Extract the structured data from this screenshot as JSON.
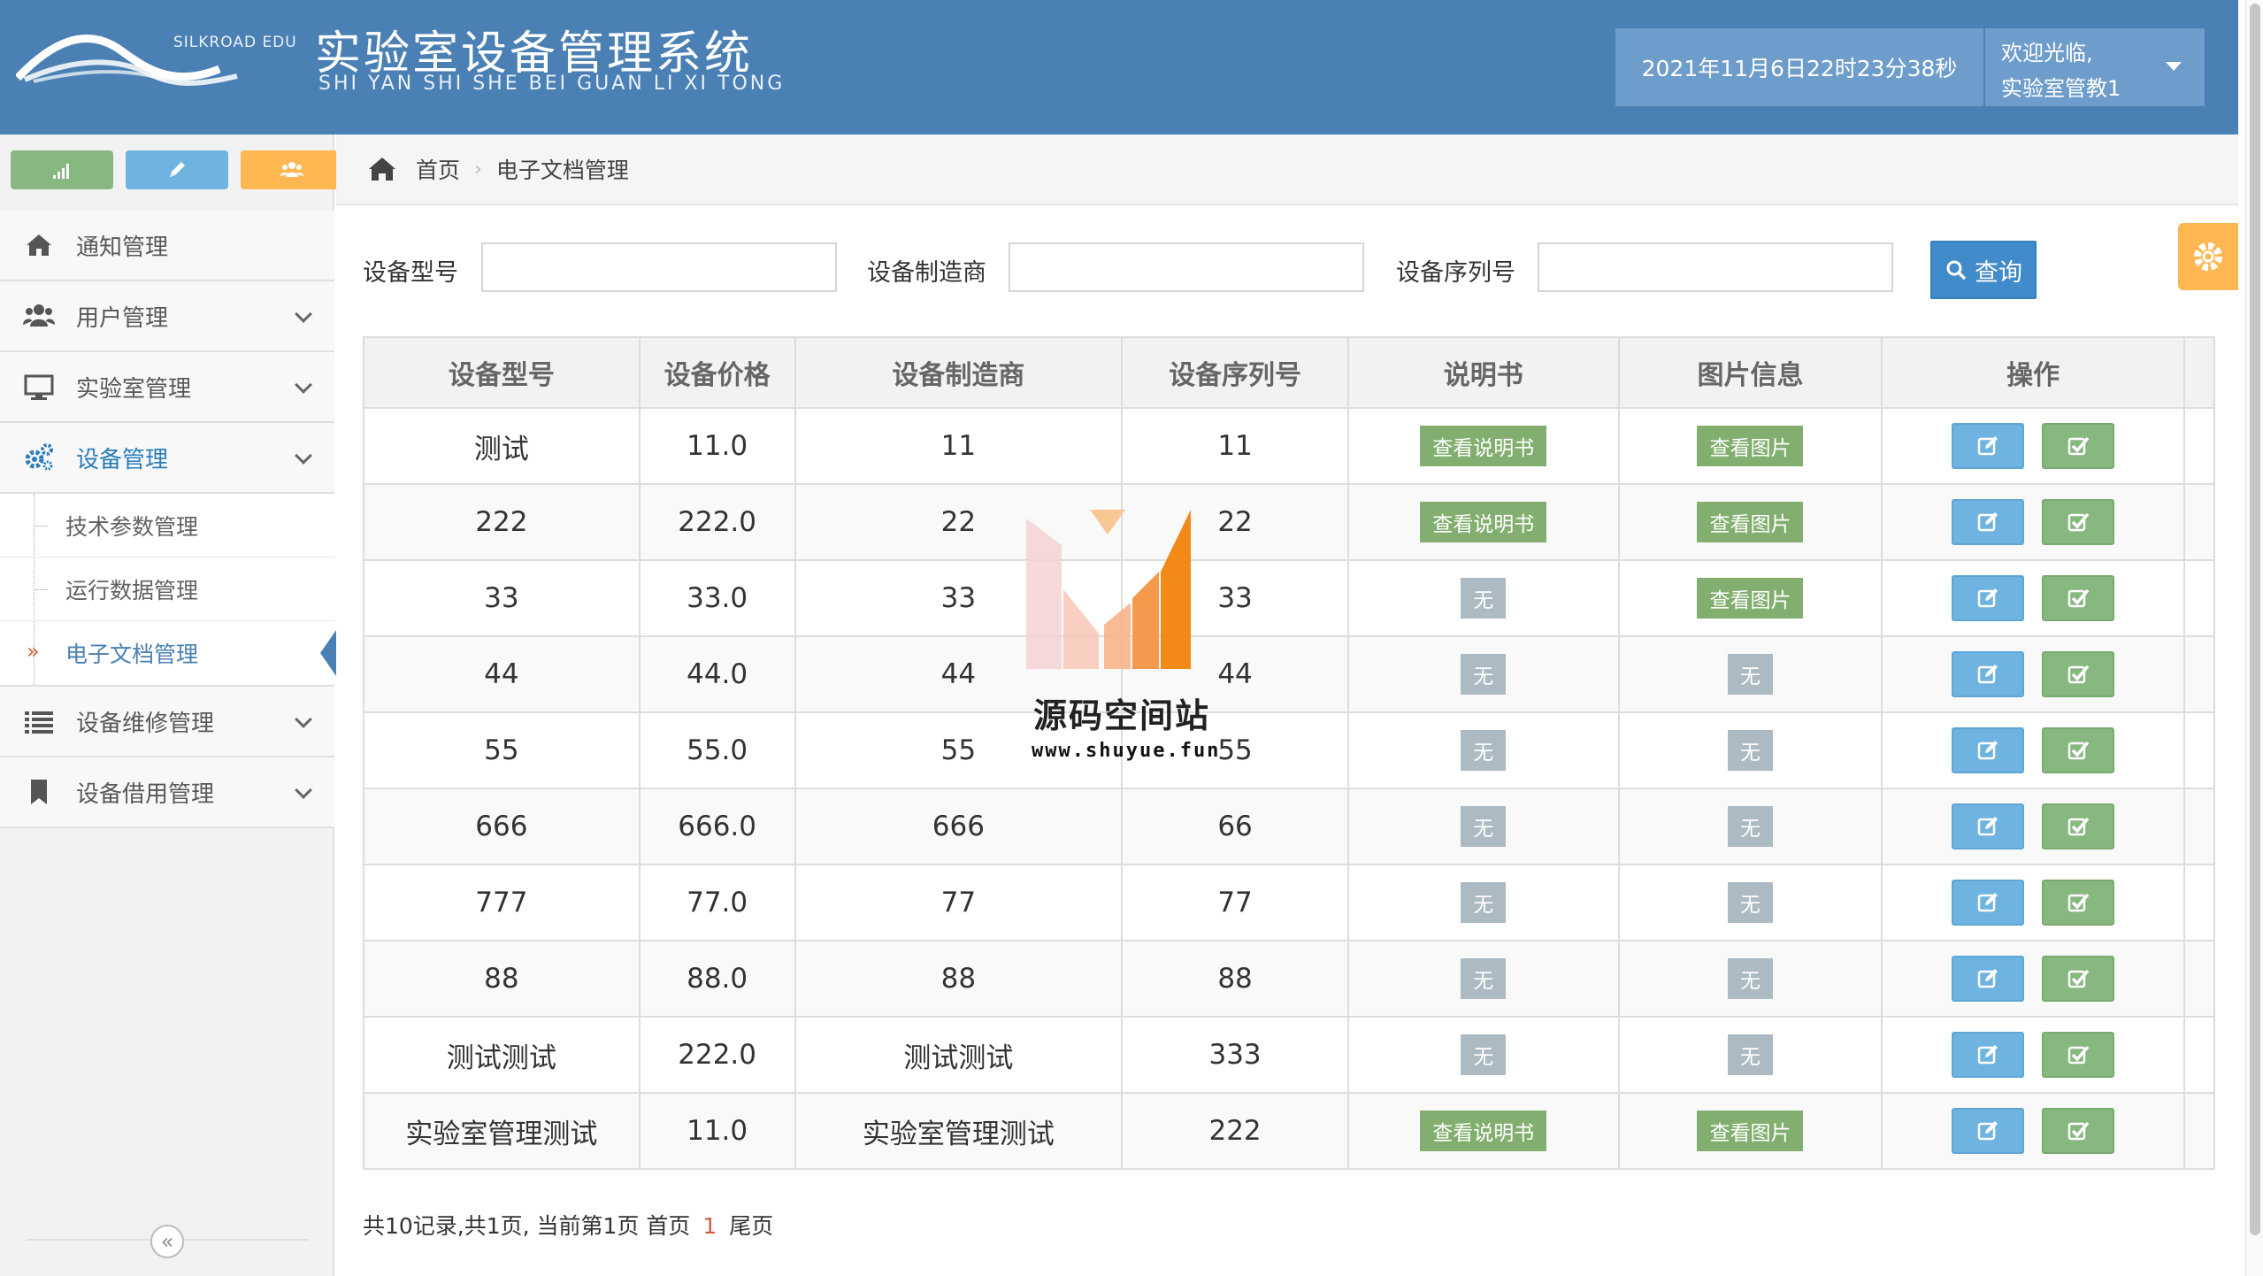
{
  "header": {
    "logo_text": "SILKROAD EDU",
    "title": "实验室设备管理系统",
    "pinyin": "SHI YAN SHI SHE BEI GUAN LI XI TONG",
    "datetime": "2021年11月6日22时23分38秒",
    "welcome": "欢迎光临,",
    "username": "实验室管教1"
  },
  "sidebar": {
    "shortcuts": [
      {
        "icon": "signal-icon",
        "color": "#87b87f"
      },
      {
        "icon": "pencil-icon",
        "color": "#6fb3e0"
      },
      {
        "icon": "users-icon",
        "color": "#ffb752"
      },
      {
        "icon": "cogs-icon",
        "color": "#d15b47"
      }
    ],
    "items": [
      {
        "label": "通知管理",
        "icon": "home-icon"
      },
      {
        "label": "用户管理",
        "icon": "users-icon"
      },
      {
        "label": "实验室管理",
        "icon": "desktop-icon"
      },
      {
        "label": "设备管理",
        "icon": "cogs-icon"
      },
      {
        "label": "设备维修管理",
        "icon": "list-icon"
      },
      {
        "label": "设备借用管理",
        "icon": "bookmark-icon"
      }
    ],
    "subitems": [
      {
        "label": "技术参数管理"
      },
      {
        "label": "运行数据管理"
      },
      {
        "label": "电子文档管理"
      }
    ],
    "collapse_symbol": "«"
  },
  "breadcrumb": {
    "home": "首页",
    "separator": "›",
    "current": "电子文档管理"
  },
  "search": {
    "model_label": "设备型号",
    "maker_label": "设备制造商",
    "serial_label": "设备序列号",
    "model_value": "",
    "maker_value": "",
    "serial_value": "",
    "button_label": "查询"
  },
  "table": {
    "headers": [
      "设备型号",
      "设备价格",
      "设备制造商",
      "设备序列号",
      "说明书",
      "图片信息",
      "操作"
    ],
    "rows": [
      {
        "model": "测试",
        "price": "11.0",
        "maker": "11",
        "serial": "11",
        "manual": "查看说明书",
        "manual_type": "green",
        "image": "查看图片",
        "image_type": "green"
      },
      {
        "model": "222",
        "price": "222.0",
        "maker": "22",
        "serial": "22",
        "manual": "查看说明书",
        "manual_type": "green",
        "image": "查看图片",
        "image_type": "green"
      },
      {
        "model": "33",
        "price": "33.0",
        "maker": "33",
        "serial": "33",
        "manual": "无",
        "manual_type": "gray",
        "image": "查看图片",
        "image_type": "green"
      },
      {
        "model": "44",
        "price": "44.0",
        "maker": "44",
        "serial": "44",
        "manual": "无",
        "manual_type": "gray",
        "image": "无",
        "image_type": "gray"
      },
      {
        "model": "55",
        "price": "55.0",
        "maker": "55",
        "serial": "55",
        "manual": "无",
        "manual_type": "gray",
        "image": "无",
        "image_type": "gray"
      },
      {
        "model": "666",
        "price": "666.0",
        "maker": "666",
        "serial": "66",
        "manual": "无",
        "manual_type": "gray",
        "image": "无",
        "image_type": "gray"
      },
      {
        "model": "777",
        "price": "77.0",
        "maker": "77",
        "serial": "77",
        "manual": "无",
        "manual_type": "gray",
        "image": "无",
        "image_type": "gray"
      },
      {
        "model": "88",
        "price": "88.0",
        "maker": "88",
        "serial": "88",
        "manual": "无",
        "manual_type": "gray",
        "image": "无",
        "image_type": "gray"
      },
      {
        "model": "测试测试",
        "price": "222.0",
        "maker": "测试测试",
        "serial": "333",
        "manual": "无",
        "manual_type": "gray",
        "image": "无",
        "image_type": "gray"
      },
      {
        "model": "实验室管理测试",
        "price": "11.0",
        "maker": "实验室管理测试",
        "serial": "222",
        "manual": "查看说明书",
        "manual_type": "green",
        "image": "查看图片",
        "image_type": "green"
      }
    ]
  },
  "pager": {
    "summary": "共10记录,共1页, 当前第1页",
    "first": "首页",
    "current_page": "1",
    "last": "尾页"
  },
  "watermark": {
    "title": "源码空间站",
    "url": "www.shuyue.fun"
  },
  "colors": {
    "header_bg": "#4a80b3",
    "accent_blue": "#428bca",
    "tag_green": "#82af6f",
    "tag_gray": "#abbac3",
    "btn_edit": "#6fb3e0",
    "btn_check": "#87b87f",
    "settings_orange": "#ffb752"
  }
}
